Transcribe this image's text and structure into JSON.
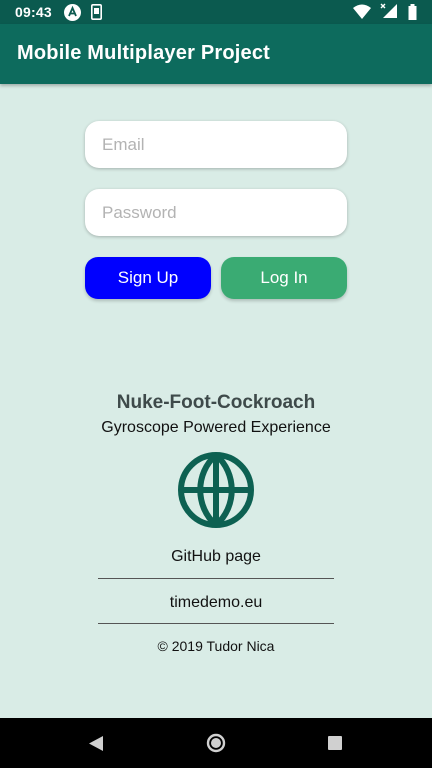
{
  "status_bar": {
    "time": "09:43",
    "icons": [
      "android-icon",
      "sim-icon",
      "wifi-icon",
      "signal-icon",
      "battery-icon"
    ]
  },
  "app_bar": {
    "title": "Mobile Multiplayer Project",
    "color": "#0d6b5d"
  },
  "login_form": {
    "email_placeholder": "Email",
    "email_value": "",
    "password_placeholder": "Password",
    "password_value": "",
    "signup_label": "Sign Up",
    "login_label": "Log In",
    "signup_color": "#0000ff",
    "login_color": "#3aab73"
  },
  "project_info": {
    "title": "Nuke-Foot-Cockroach",
    "subtitle": "Gyroscope Powered Experience",
    "icon": "globe-icon",
    "github_link": "GitHub page",
    "website_link": "timedemo.eu",
    "copyright": "© 2019 Tudor Nica"
  },
  "nav_bar": {
    "buttons": [
      "back-icon",
      "home-icon",
      "recents-icon"
    ]
  }
}
